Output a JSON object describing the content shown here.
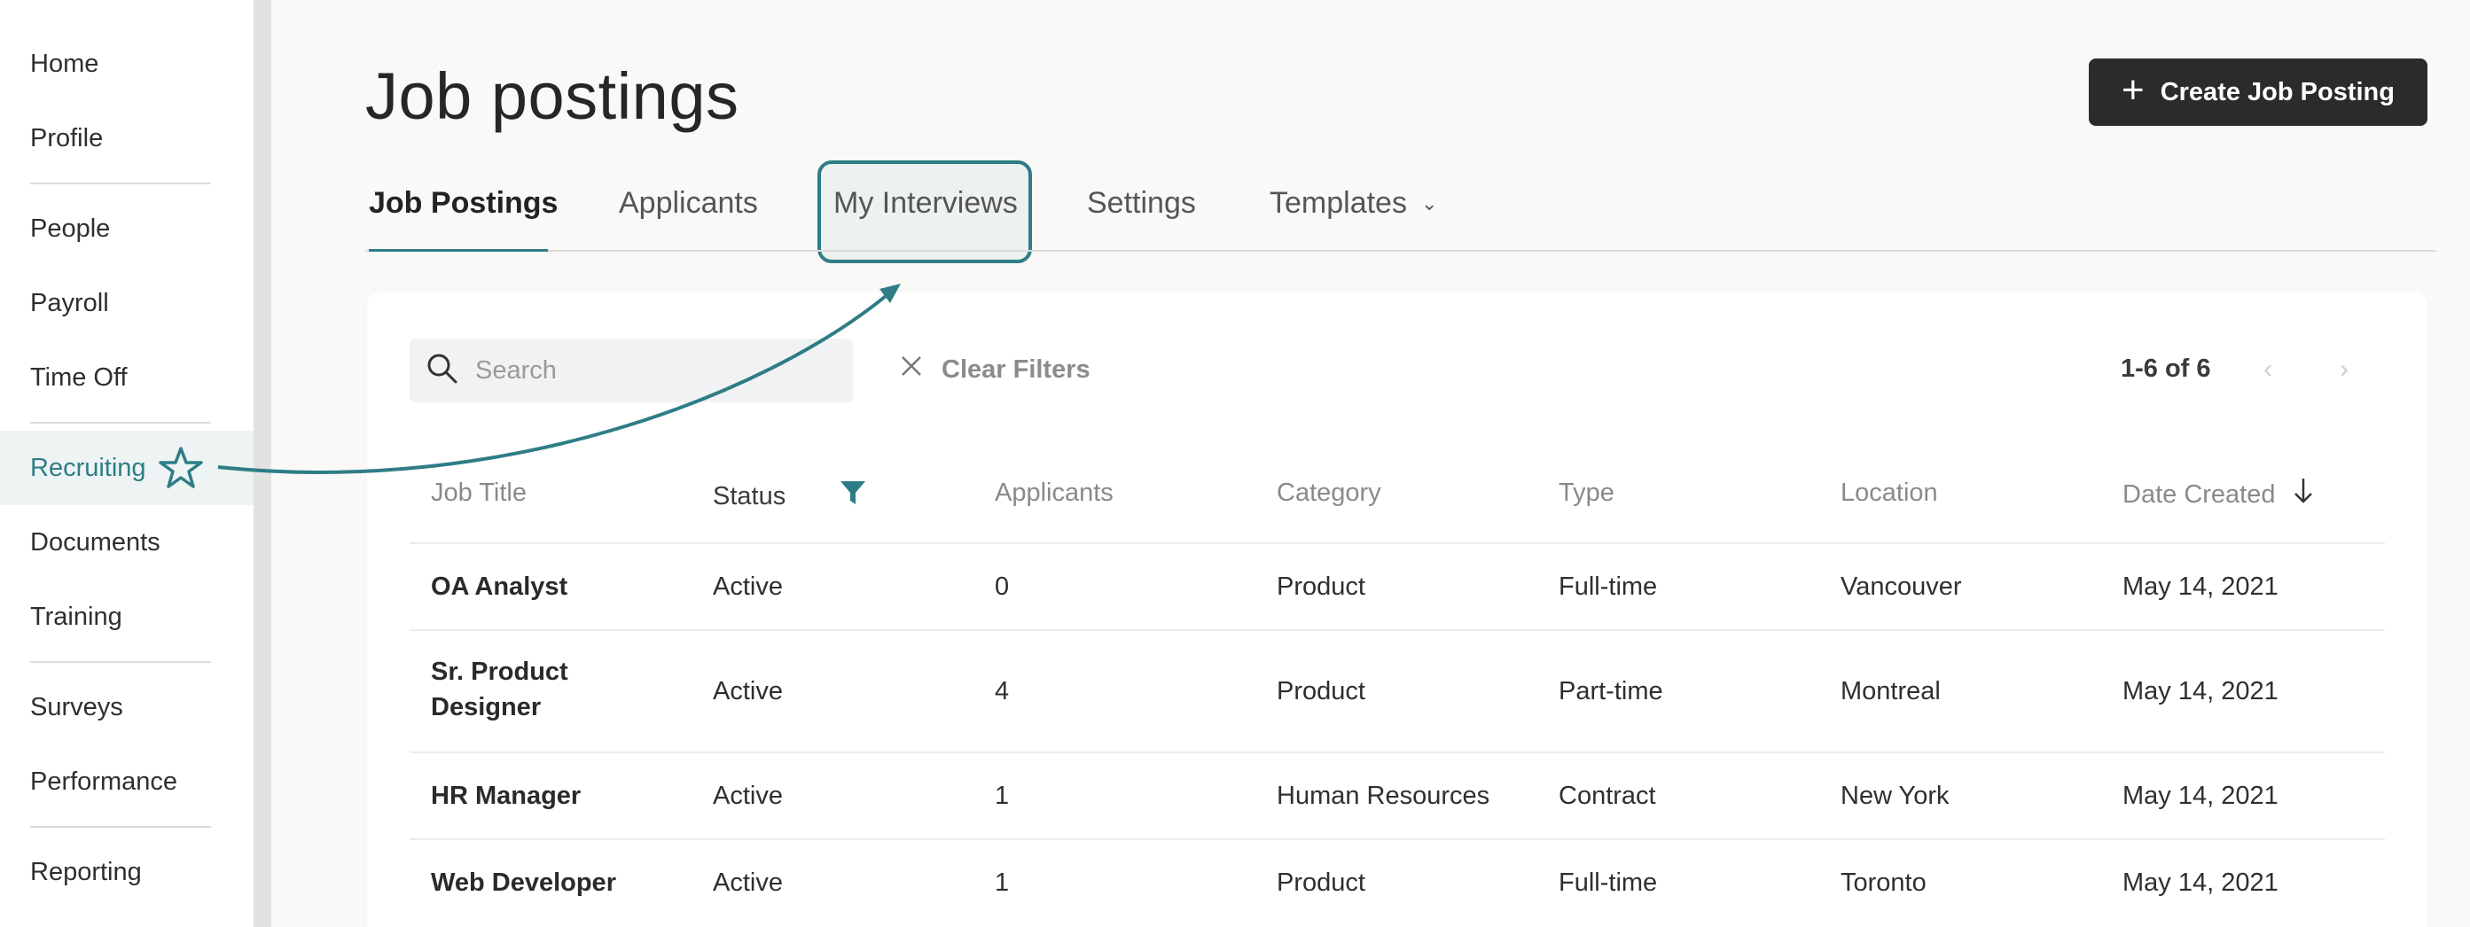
{
  "sidebar": {
    "items": [
      {
        "label": "Home"
      },
      {
        "label": "Profile"
      },
      {
        "label": "People"
      },
      {
        "label": "Payroll"
      },
      {
        "label": "Time Off"
      },
      {
        "label": "Recruiting"
      },
      {
        "label": "Documents"
      },
      {
        "label": "Training"
      },
      {
        "label": "Surveys"
      },
      {
        "label": "Performance"
      },
      {
        "label": "Reporting"
      }
    ]
  },
  "header": {
    "title": "Job postings",
    "create_button_label": "Create Job Posting"
  },
  "tabs": [
    {
      "label": "Job Postings"
    },
    {
      "label": "Applicants"
    },
    {
      "label": "My Interviews"
    },
    {
      "label": "Settings"
    },
    {
      "label": "Templates"
    }
  ],
  "toolbar": {
    "search_placeholder": "Search",
    "clear_filters_label": "Clear Filters",
    "pagination": "1-6 of 6"
  },
  "table": {
    "columns": [
      "Job Title",
      "Status",
      "Applicants",
      "Category",
      "Type",
      "Location",
      "Date Created"
    ],
    "rows": [
      {
        "title": "OA Analyst",
        "status": "Active",
        "applicants": "0",
        "category": "Product",
        "type": "Full-time",
        "location": "Vancouver",
        "date": "May 14, 2021"
      },
      {
        "title_line1": "Sr. Product",
        "title_line2": "Designer",
        "status": "Active",
        "applicants": "4",
        "category": "Product",
        "type": "Part-time",
        "location": "Montreal",
        "date": "May 14, 2021"
      },
      {
        "title": "HR Manager",
        "status": "Active",
        "applicants": "1",
        "category": "Human Resources",
        "type": "Contract",
        "location": "New York",
        "date": "May 14, 2021"
      },
      {
        "title": "Web Developer",
        "status": "Active",
        "applicants": "1",
        "category": "Product",
        "type": "Full-time",
        "location": "Toronto",
        "date": "May 14, 2021"
      }
    ]
  },
  "colors": {
    "accent": "#2e7d86",
    "button_bg": "#2a2b2d",
    "active_nav_bg": "#eef3f3"
  }
}
